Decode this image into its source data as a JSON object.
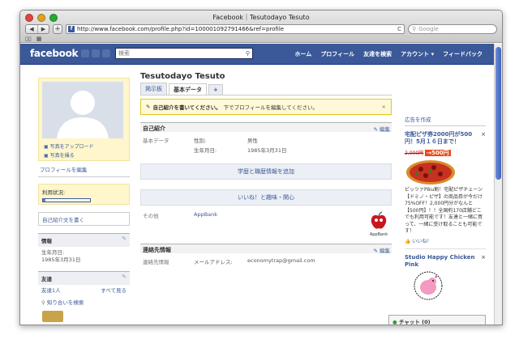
{
  "window": {
    "title": "Facebook｜Tesutodayo Tesuto"
  },
  "browser": {
    "url": "http://www.facebook.com/profile.php?id=100001092791466&ref=profile",
    "search_placeholder": "Google",
    "back": "◀",
    "forward": "▶",
    "add": "+",
    "reload": "C"
  },
  "topbar": {
    "logo": "facebook",
    "search_placeholder": "検索",
    "nav": [
      "ホーム",
      "プロフィール",
      "友達を検索",
      "アカウント ▾",
      "フィードバック"
    ]
  },
  "left": {
    "upload_photo": "写真をアップロード",
    "take_photo": "写真を撮る",
    "edit_profile": "プロフィールを編集",
    "usage_label": "利用状況:",
    "usage_fraction": 0.05,
    "write_intro": "自己紹介文を書く",
    "info_title": "情報",
    "birthday_label": "生年月日:",
    "birthday": "1985年3月31日",
    "friends_title": "友達",
    "friends_count": "友達1人",
    "see_all": "すべて見る",
    "find_friends": "知り合いを検索"
  },
  "profile": {
    "name": "Tesutodayo Tesuto",
    "tabs": [
      "掲示板",
      "基本データ",
      "+"
    ]
  },
  "notice": {
    "text_bold": "自己紹介を書いてください。",
    "text": "下でプロフィールを編集してください。",
    "close": "×"
  },
  "sections": {
    "intro_title": "自己紹介",
    "edit": "編集",
    "basic_label": "基本データ",
    "gender_label": "性別:",
    "gender": "男性",
    "birthday_label": "生年月日:",
    "birthday": "1985年3月31日",
    "add_education": "学歴と職歴情報を追加",
    "likes_button": "いいね！と趣味・関心",
    "other_label": "その他",
    "other_value": "AppBank",
    "appbank_caption": "AppBank",
    "contact_title": "連絡先情報",
    "contact_label": "連絡先情報",
    "email_label": "メールアドレス:",
    "email": "economytrap@gmail.com"
  },
  "ads": {
    "create_ad": "広告を作成",
    "ad1_title": "宅配ピザ券2000円が500円！5月１６日まで！",
    "ad1_price_old": "2,000円",
    "ad1_price_new": "500円",
    "ad1_body": "ピッツァPiku割！宅配ピザチェーン【ドミノ・ピザ】の商品券が今だけ75%OFF！2,000円分がなんと【500円】！！全国約170店舗どこでも利用可能です！友達と一緒に買って、一緒に受け取ることも可能です！",
    "like": "いいね！",
    "ad2_title": "Studio Happy Chicken Pink",
    "close": "×"
  },
  "chat": {
    "label": "チャット (0)"
  }
}
